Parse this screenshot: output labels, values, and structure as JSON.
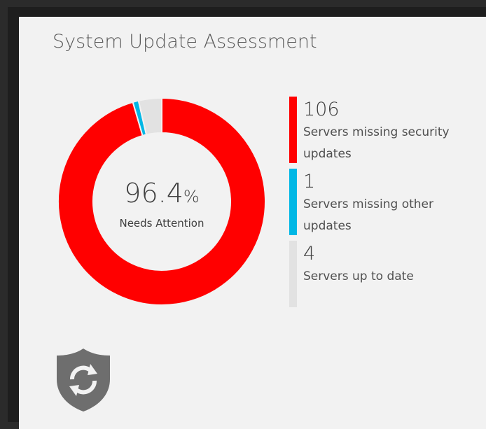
{
  "tile": {
    "title": "System Update Assessment"
  },
  "donut": {
    "center_value": "96.4",
    "center_unit": "%",
    "center_label": "Needs Attention"
  },
  "legend": [
    {
      "value": "106",
      "label": "Servers missing security updates",
      "color": "#ff0000"
    },
    {
      "value": "1",
      "label": "Servers missing other updates",
      "color": "#00b7e5"
    },
    {
      "value": "4",
      "label": "Servers up to date",
      "color": "#e2e2e2"
    }
  ],
  "chart_data": {
    "type": "pie",
    "categories": [
      "Servers missing security updates",
      "Servers missing other updates",
      "Servers up to date"
    ],
    "values": [
      106,
      1,
      4
    ],
    "colors": [
      "#ff0000",
      "#00b7e5",
      "#e2e2e2"
    ]
  },
  "icons": {
    "shield": "shield-sync-icon"
  }
}
